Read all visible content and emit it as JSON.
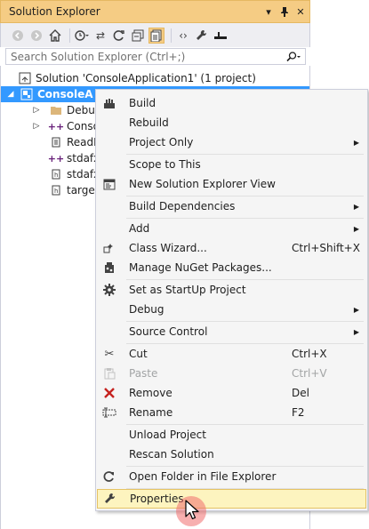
{
  "window": {
    "title": "Solution Explorer",
    "pin_icon": "pin-icon",
    "close_icon": "close-icon",
    "dropdown_icon": "chevron-down-icon"
  },
  "toolbar": {
    "buttons": [
      "back-icon",
      "forward-icon",
      "home-icon",
      "history-icon",
      "sync-icon",
      "refresh-icon",
      "collapse-all-icon",
      "show-all-files-icon",
      "view-code-icon",
      "properties-icon",
      "preview-icon"
    ]
  },
  "search": {
    "placeholder": "Search Solution Explorer (Ctrl+;)"
  },
  "tree": {
    "items": [
      {
        "label": "Solution 'ConsoleApplication1' (1 project)"
      },
      {
        "label": "ConsoleA"
      },
      {
        "label": "Debug"
      },
      {
        "label": "Conso"
      },
      {
        "label": "ReadM"
      },
      {
        "label": "stdafx"
      },
      {
        "label": "stdafx"
      },
      {
        "label": "target"
      }
    ]
  },
  "menu": {
    "items": [
      {
        "label": "Build",
        "icon": "build-icon"
      },
      {
        "label": "Rebuild"
      },
      {
        "label": "Project Only",
        "submenu": true
      },
      {
        "label": "Scope to This"
      },
      {
        "label": "New Solution Explorer View",
        "icon": "new-view-icon"
      },
      {
        "label": "Build Dependencies",
        "submenu": true
      },
      {
        "label": "Add",
        "submenu": true
      },
      {
        "label": "Class Wizard...",
        "shortcut": "Ctrl+Shift+X",
        "icon": "class-wizard-icon"
      },
      {
        "label": "Manage NuGet Packages...",
        "icon": "nuget-icon"
      },
      {
        "label": "Set as StartUp Project",
        "icon": "gear-icon"
      },
      {
        "label": "Debug",
        "submenu": true
      },
      {
        "label": "Source Control",
        "submenu": true
      },
      {
        "label": "Cut",
        "shortcut": "Ctrl+X",
        "icon": "scissors-icon"
      },
      {
        "label": "Paste",
        "shortcut": "Ctrl+V",
        "icon": "paste-icon",
        "disabled": true
      },
      {
        "label": "Remove",
        "shortcut": "Del",
        "icon": "remove-icon"
      },
      {
        "label": "Rename",
        "shortcut": "F2",
        "icon": "rename-icon"
      },
      {
        "label": "Unload Project"
      },
      {
        "label": "Rescan Solution"
      },
      {
        "label": "Open Folder in File Explorer",
        "icon": "open-folder-icon"
      },
      {
        "label": "Properties",
        "icon": "wrench-icon",
        "hover": true
      }
    ]
  },
  "colors": {
    "title_bg": "#f5cc84",
    "selection": "#3399ff",
    "menu_hover": "#fdf4bf",
    "remove_icon": "#c5221f"
  }
}
